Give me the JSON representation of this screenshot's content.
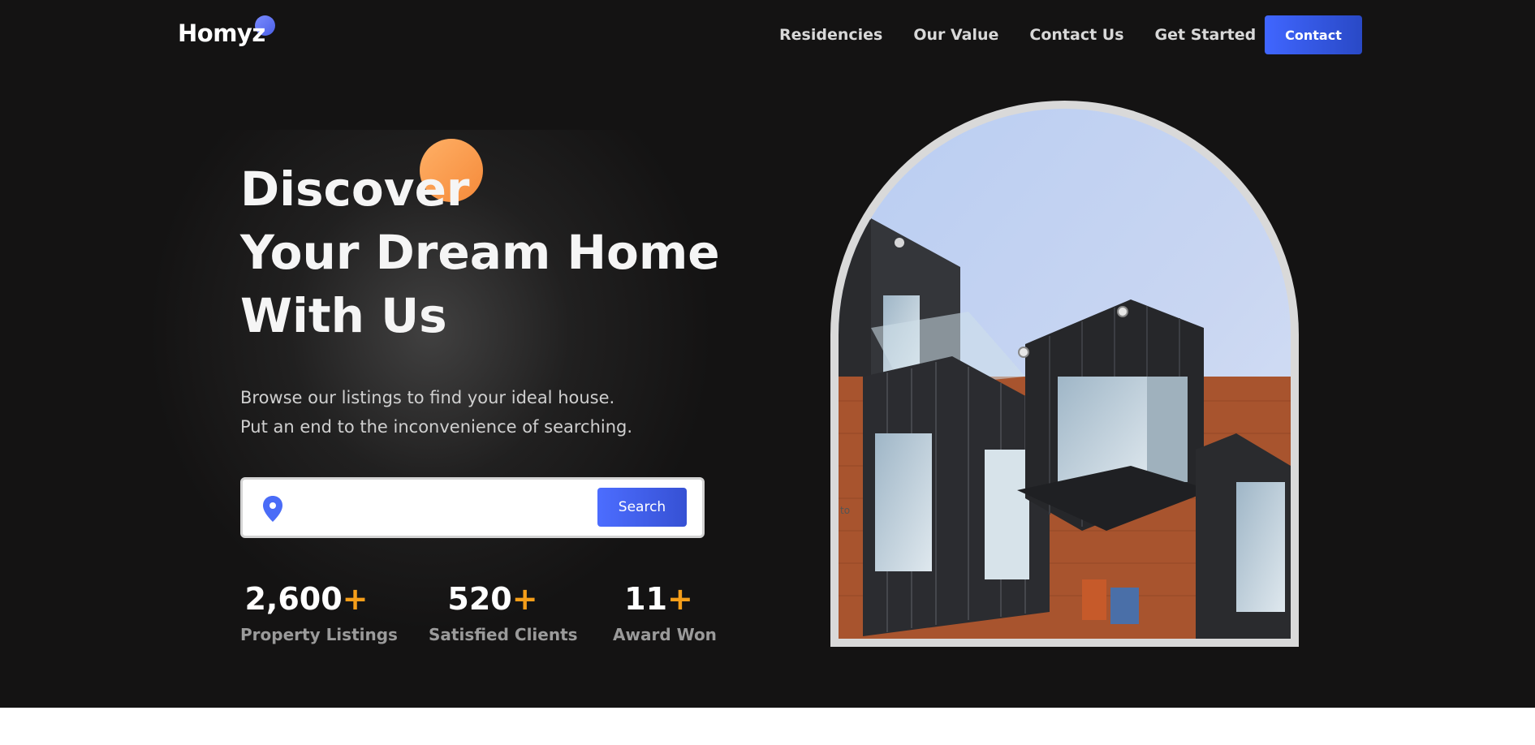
{
  "header": {
    "logo": "Homyz",
    "nav": [
      "Residencies",
      "Our Value",
      "Contact Us",
      "Get Started"
    ],
    "cta_label": "Contact"
  },
  "hero": {
    "title_lines": [
      "Discover",
      "Your Dream Home",
      "With Us"
    ],
    "description_lines": [
      "Browse our listings to find your ideal house.",
      "Put an end to the inconvenience of searching."
    ],
    "search": {
      "value": "",
      "button_label": "Search",
      "icon": "location-pin-icon"
    },
    "stats": [
      {
        "value": "2,600",
        "suffix": "+",
        "label": "Property Listings"
      },
      {
        "value": "520",
        "suffix": "+",
        "label": "Satisfied Clients"
      },
      {
        "value": "11",
        "suffix": "+",
        "label": "Award Won"
      }
    ],
    "image_alt_fragment": "to"
  },
  "colors": {
    "background": "#141313",
    "accent_blue": "#4066ff",
    "accent_orange": "#f59e1a",
    "circle_orange": "#ffa45b"
  }
}
